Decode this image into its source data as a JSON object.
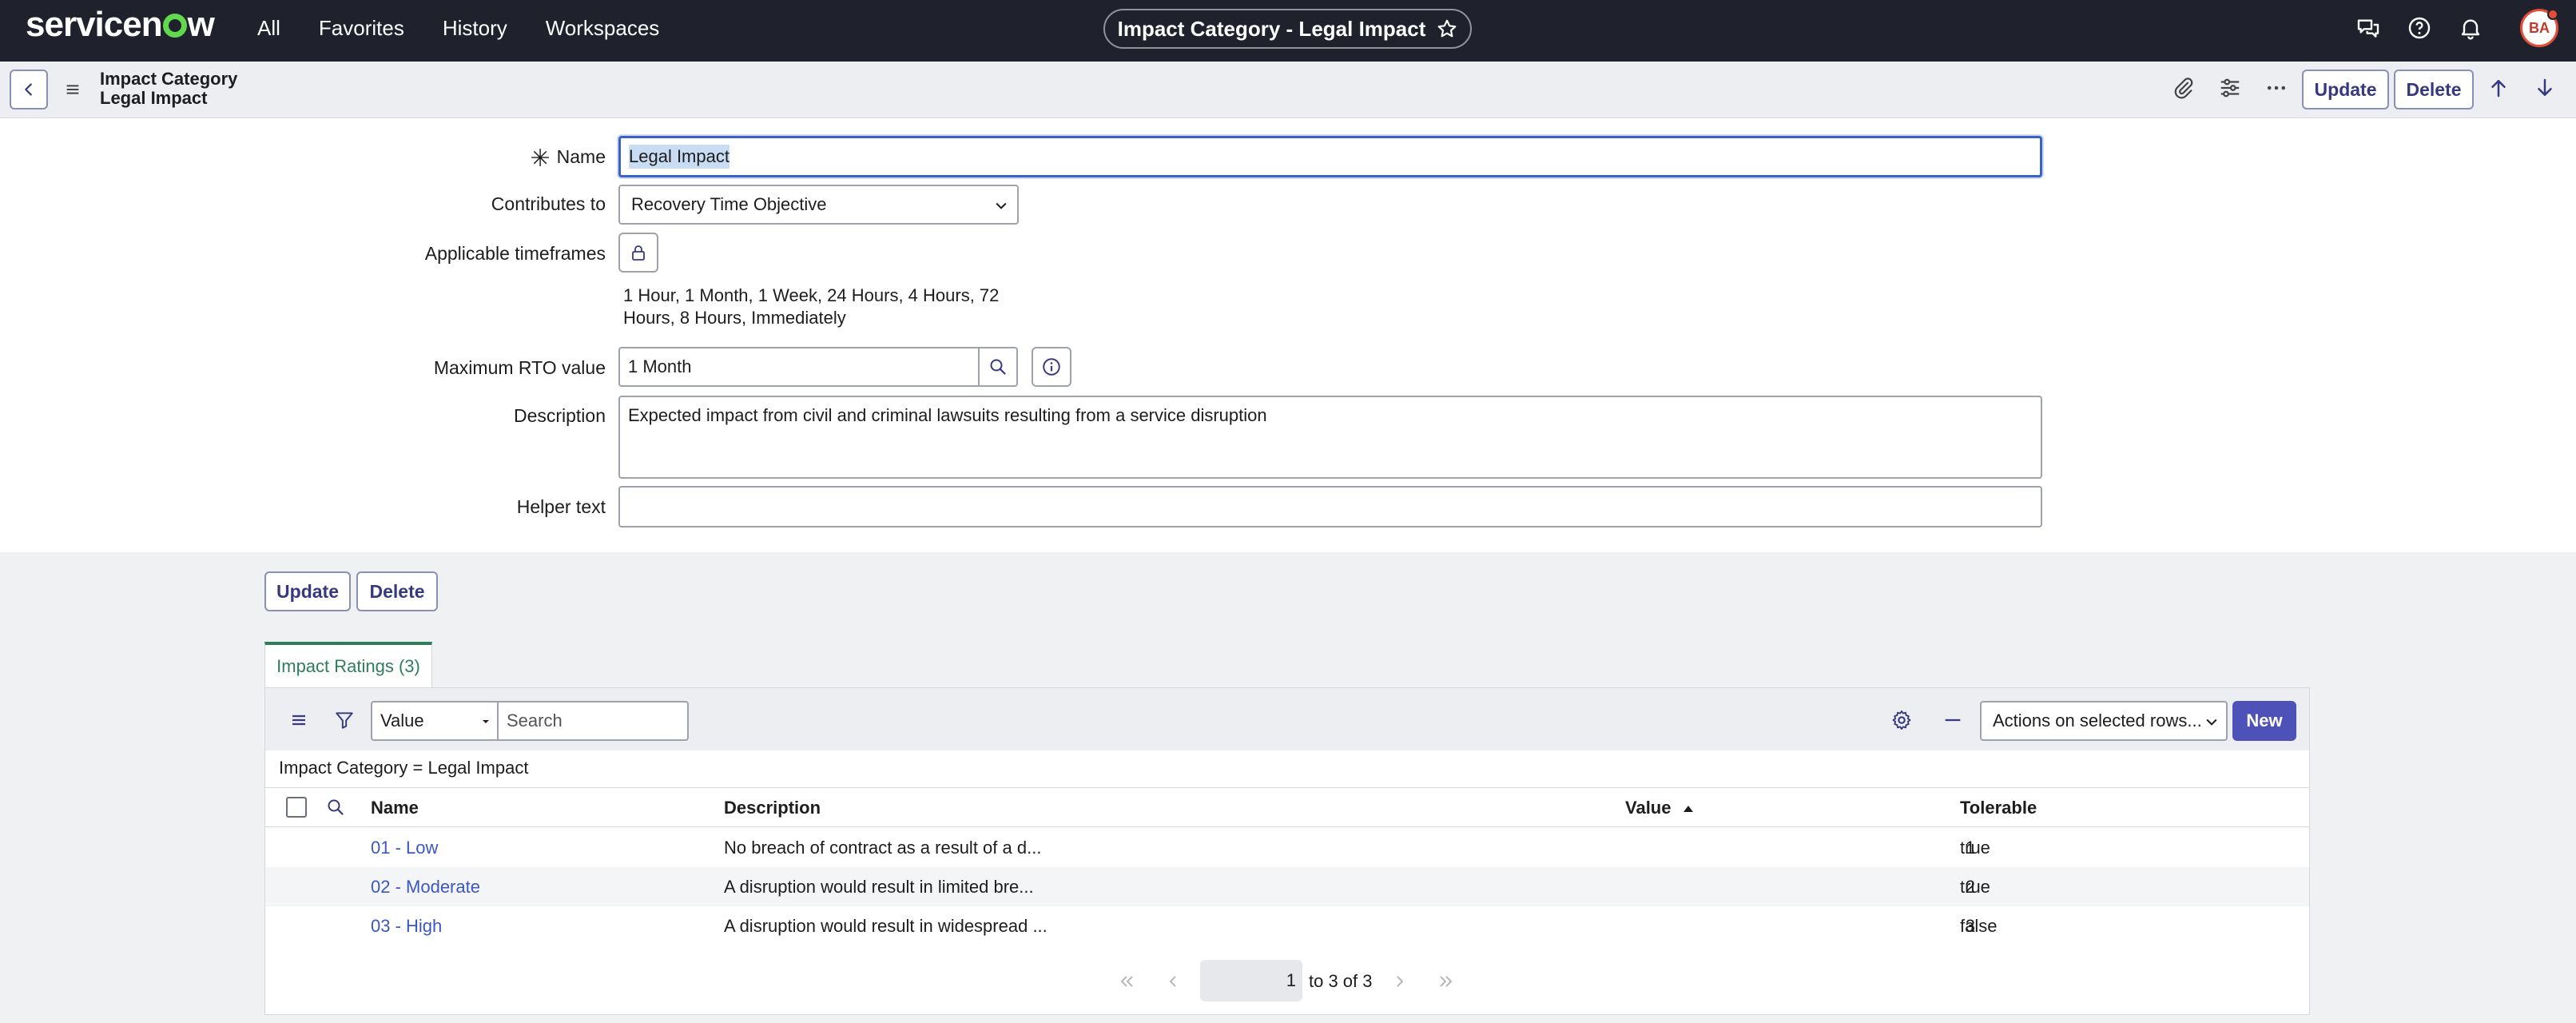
{
  "nav": {
    "brand": "servicenow",
    "links": [
      "All",
      "Favorites",
      "History",
      "Workspaces"
    ],
    "record_title": "Impact Category - Legal Impact",
    "avatar_initials": "BA"
  },
  "header": {
    "title_line1": "Impact Category",
    "title_line2": "Legal Impact",
    "update_label": "Update",
    "delete_label": "Delete"
  },
  "form": {
    "name_label": "Name",
    "name_value": "Legal Impact",
    "contributes_label": "Contributes to",
    "contributes_value": "Recovery Time Objective",
    "timeframes_label": "Applicable timeframes",
    "timeframes_value": "1 Hour, 1 Month, 1 Week, 24 Hours, 4 Hours, 72 Hours, 8 Hours, Immediately",
    "max_rto_label": "Maximum RTO value",
    "max_rto_value": "1 Month",
    "description_label": "Description",
    "description_value": "Expected impact from civil and criminal lawsuits resulting from a service disruption",
    "helper_label": "Helper text",
    "helper_value": ""
  },
  "form_actions": {
    "update_label": "Update",
    "delete_label": "Delete"
  },
  "related_list": {
    "tab_label": "Impact Ratings (3)",
    "filter_field": "Value",
    "search_placeholder": "Search",
    "actions_label": "Actions on selected rows...",
    "new_label": "New",
    "breadcrumb": "Impact Category = Legal Impact",
    "columns": [
      "Name",
      "Description",
      "Value",
      "Tolerable"
    ],
    "rows": [
      {
        "name": "01 - Low",
        "description": "No breach of contract as a result of a d...",
        "value": "1",
        "tolerable": "true"
      },
      {
        "name": "02 - Moderate",
        "description": "A disruption would result in limited bre...",
        "value": "2",
        "tolerable": "true"
      },
      {
        "name": "03 - High",
        "description": "A disruption would result in widespread ...",
        "value": "3",
        "tolerable": "false"
      }
    ],
    "pager": {
      "page": "1",
      "range_text": "to 3 of 3"
    }
  }
}
